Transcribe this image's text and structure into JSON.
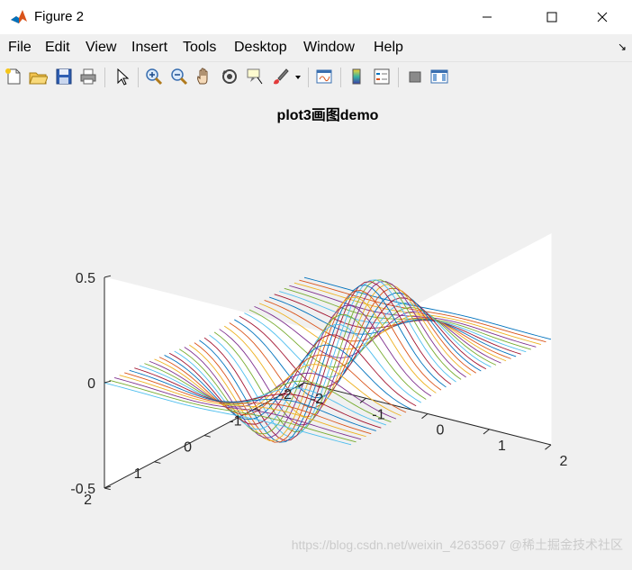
{
  "window": {
    "title": "Figure 2",
    "controls": {
      "minimize": "—",
      "maximize": "☐",
      "close": "✕"
    }
  },
  "menu": {
    "items": [
      "File",
      "Edit",
      "View",
      "Insert",
      "Tools",
      "Desktop",
      "Window",
      "Help"
    ],
    "dock_arrow": "↘"
  },
  "toolbar": {
    "buttons": [
      "new-figure-icon",
      "open-file-icon",
      "save-icon",
      "print-icon",
      "edit-plot-cursor-icon",
      "zoom-in-icon",
      "zoom-out-icon",
      "pan-hand-icon",
      "rotate-3d-icon",
      "data-cursor-icon",
      "brush-icon",
      "brush-dropdown-icon",
      "link-plot-icon",
      "insert-colorbar-icon",
      "insert-legend-icon",
      "hide-plot-tools-icon",
      "show-plot-tools-icon"
    ]
  },
  "watermark": "https://blog.csdn.net/weixin_42635697 @稀土掘金技术社区",
  "colors": {
    "matlab_order": [
      "#0072BD",
      "#D95319",
      "#EDB120",
      "#7E2F8E",
      "#77AC30",
      "#4DBEEE",
      "#A2142F"
    ],
    "axes_bg": "#ffffff",
    "figure_bg": "#f0f0f0"
  },
  "chart_data": {
    "type": "line",
    "title": "plot3画图demo",
    "xlabel": "",
    "ylabel": "",
    "zlabel": "",
    "xlim": [
      -2,
      2
    ],
    "ylim": [
      -2,
      2
    ],
    "zlim": [
      -0.5,
      0.5
    ],
    "x_ticks": [
      -2,
      -1,
      0,
      1,
      2
    ],
    "y_ticks": [
      -2,
      -1,
      0,
      1,
      2
    ],
    "z_ticks": [
      -0.5,
      0,
      0.5
    ],
    "x_tick_labels": [
      "-2",
      "-1",
      "0",
      "1",
      "2"
    ],
    "y_tick_labels": [
      "-2",
      "-1",
      "0",
      "1",
      "2"
    ],
    "z_tick_labels": [
      "-0.5",
      "0",
      "0.5"
    ],
    "function": "z = x * exp(-x^2 - y^2)",
    "x_samples": 41,
    "series_y_values": [
      -2.0,
      -1.9,
      -1.8,
      -1.7,
      -1.6,
      -1.5,
      -1.4,
      -1.3,
      -1.2,
      -1.1,
      -1.0,
      -0.9,
      -0.8,
      -0.7,
      -0.6,
      -0.5,
      -0.4,
      -0.3,
      -0.2,
      -0.1,
      0.0,
      0.1,
      0.2,
      0.3,
      0.4,
      0.5,
      0.6,
      0.7,
      0.8,
      0.9,
      1.0,
      1.1,
      1.2,
      1.3,
      1.4,
      1.5,
      1.6,
      1.7,
      1.8,
      1.9,
      2.0
    ],
    "view": {
      "azimuth": -37.5,
      "elevation": 30
    },
    "grid": false,
    "box": "open-3d"
  }
}
